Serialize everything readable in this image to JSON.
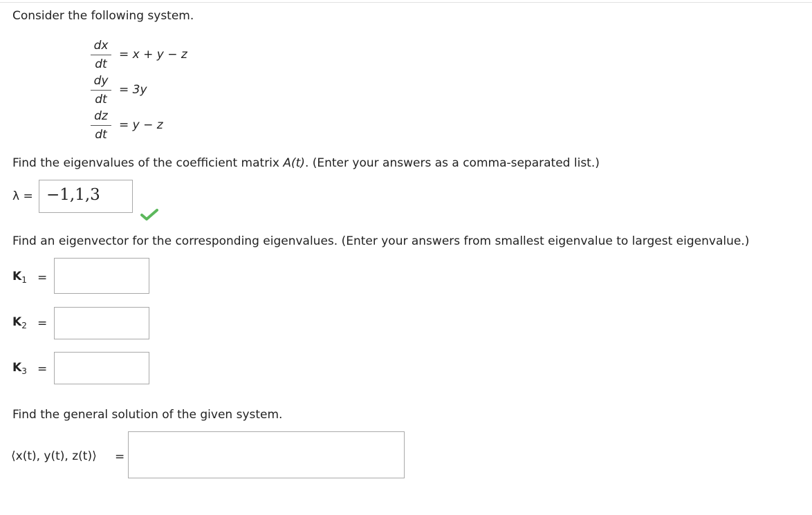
{
  "intro": "Consider the following system.",
  "system": [
    {
      "num": "dx",
      "den": "dt",
      "eq": "=",
      "rhs": "x + y − z"
    },
    {
      "num": "dy",
      "den": "dt",
      "eq": "=",
      "rhs": "3y"
    },
    {
      "num": "dz",
      "den": "dt",
      "eq": "=",
      "rhs": "y − z"
    }
  ],
  "q1": {
    "text_before": "Find the eigenvalues of the coefficient matrix ",
    "math": "A(t)",
    "text_after": ". (Enter your answers as a comma-separated list.)",
    "label": "λ =",
    "answer": "−1,1,3",
    "status": "correct"
  },
  "q2": {
    "text": "Find an eigenvector for the corresponding eigenvalues. (Enter your answers from smallest eigenvalue to largest eigenvalue.)",
    "items": [
      {
        "label": "K",
        "sub": "1",
        "eq": "=",
        "value": ""
      },
      {
        "label": "K",
        "sub": "2",
        "eq": "=",
        "value": ""
      },
      {
        "label": "K",
        "sub": "3",
        "eq": "=",
        "value": ""
      }
    ]
  },
  "q3": {
    "text": "Find the general solution of the given system.",
    "label": "⟨x(t), y(t), z(t)⟩",
    "eq": "=",
    "value": ""
  },
  "colors": {
    "check": "#5cb85c",
    "border": "#a9a9a9"
  }
}
